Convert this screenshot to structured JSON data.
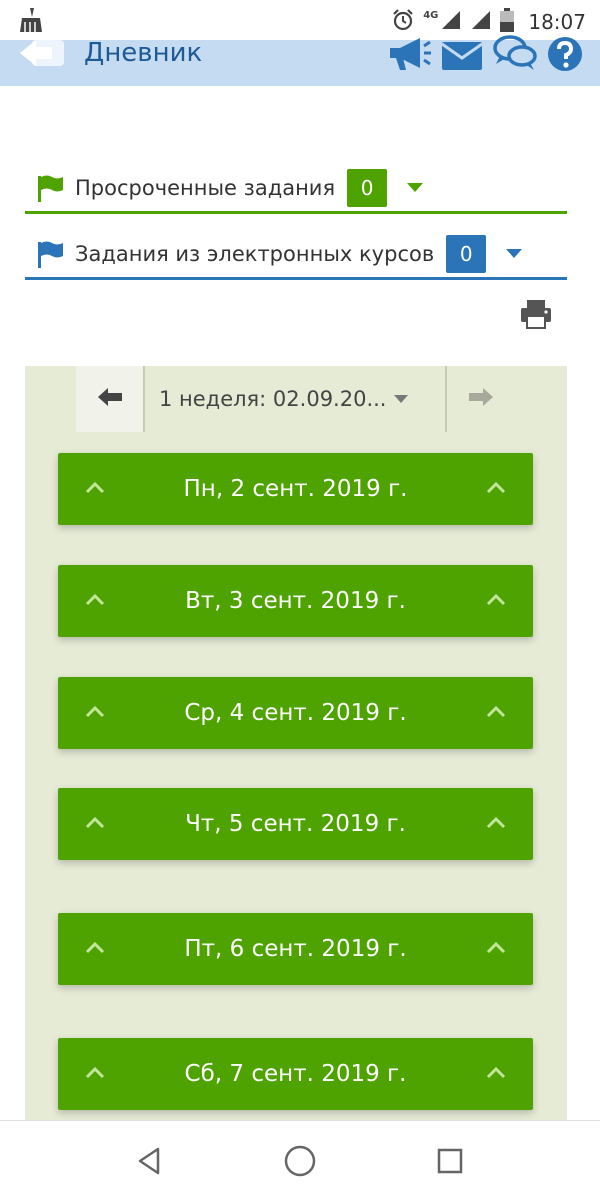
{
  "status_bar": {
    "time": "18:07",
    "network": "4G",
    "icons": [
      "cleaner-icon",
      "alarm-icon",
      "signal-icon",
      "battery-icon"
    ]
  },
  "header": {
    "title": "Дневник",
    "icons": [
      "back-icon",
      "megaphone-icon",
      "mail-icon",
      "chat-icon",
      "help-icon"
    ],
    "color": "#1e5a96",
    "background": "#c5dbf1"
  },
  "tasks": [
    {
      "label": "Просроченные задания",
      "count": "0",
      "color": "#4ea300"
    },
    {
      "label": "Задания из электронных курсов",
      "count": "0",
      "color": "#2b74b8"
    }
  ],
  "week": {
    "selected": "1 неделя: 02.09.20...",
    "prev_icon": "arrow-left-icon",
    "next_icon": "arrow-right-icon"
  },
  "days": [
    {
      "label": "Пн, 2 сент. 2019 г."
    },
    {
      "label": "Вт, 3 сент. 2019 г."
    },
    {
      "label": "Ср, 4 сент. 2019 г."
    },
    {
      "label": "Чт, 5 сент. 2019 г."
    },
    {
      "label": "Пт, 6 сент. 2019 г."
    },
    {
      "label": "Сб, 7 сент. 2019 г."
    }
  ],
  "colors": {
    "day_bar": "#4ea300",
    "panel": "#e6ebd6"
  },
  "nav": [
    "back-triangle-icon",
    "home-circle-icon",
    "recents-square-icon"
  ]
}
